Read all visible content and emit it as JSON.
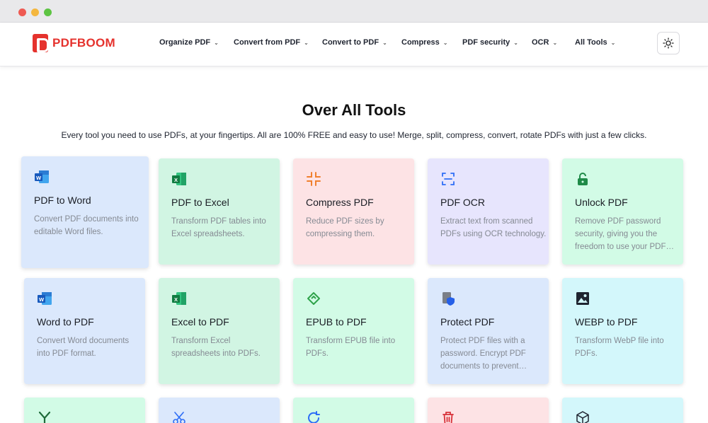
{
  "brand": {
    "name": "PDFBOOM",
    "color": "#e5322d"
  },
  "nav": [
    {
      "label": "Organize PDF"
    },
    {
      "label": "Convert from PDF"
    },
    {
      "label": "Convert to PDF"
    },
    {
      "label": "Compress"
    },
    {
      "label": "PDF security"
    },
    {
      "label": "OCR"
    },
    {
      "label": "All Tools"
    }
  ],
  "theme_toggle_icon": "sun-icon",
  "page": {
    "title": "Over All Tools",
    "subtitle": "Every tool you need to use PDFs, at your fingertips. All are 100% FREE and easy to use! Merge, split, compress, convert, rotate PDFs with just a few clicks."
  },
  "tools": [
    {
      "title": "PDF to Word",
      "desc": "Convert PDF documents into editable Word files.",
      "icon": "word-icon",
      "color": "#dbe8fc"
    },
    {
      "title": "PDF to Excel",
      "desc": "Transform PDF tables into Excel spreadsheets.",
      "icon": "excel-icon",
      "color": "#d1f5e3"
    },
    {
      "title": "Compress PDF",
      "desc": "Reduce PDF sizes by compressing them.",
      "icon": "compress-icon",
      "color": "#fde3e5"
    },
    {
      "title": "PDF OCR",
      "desc": "Extract text from scanned PDFs using OCR technology.",
      "icon": "ocr-scan-icon",
      "color": "#e7e5fd"
    },
    {
      "title": "Unlock PDF",
      "desc": "Remove PDF password security, giving you the freedom to use your PDF…",
      "icon": "unlock-icon",
      "color": "#d2fbe6"
    },
    {
      "title": "Word to PDF",
      "desc": "Convert Word documents into PDF format.",
      "icon": "word-icon",
      "color": "#dbe8fc"
    },
    {
      "title": "Excel to PDF",
      "desc": "Transform Excel spreadsheets into PDFs.",
      "icon": "excel-icon",
      "color": "#d1f5e3"
    },
    {
      "title": "EPUB to PDF",
      "desc": "Transform EPUB file into PDFs.",
      "icon": "epub-icon",
      "color": "#d2fbe6"
    },
    {
      "title": "Protect PDF",
      "desc": "Protect PDF files with a password. Encrypt PDF documents to prevent…",
      "icon": "shield-document-icon",
      "color": "#dbe8fc"
    },
    {
      "title": "WEBP to PDF",
      "desc": "Transform WebP file into PDFs.",
      "icon": "image-icon",
      "color": "#d3f7fb"
    }
  ],
  "partial_row_icons": [
    "merge-icon",
    "scissors-icon",
    "rotate-icon",
    "trash-icon",
    "cube-icon"
  ]
}
